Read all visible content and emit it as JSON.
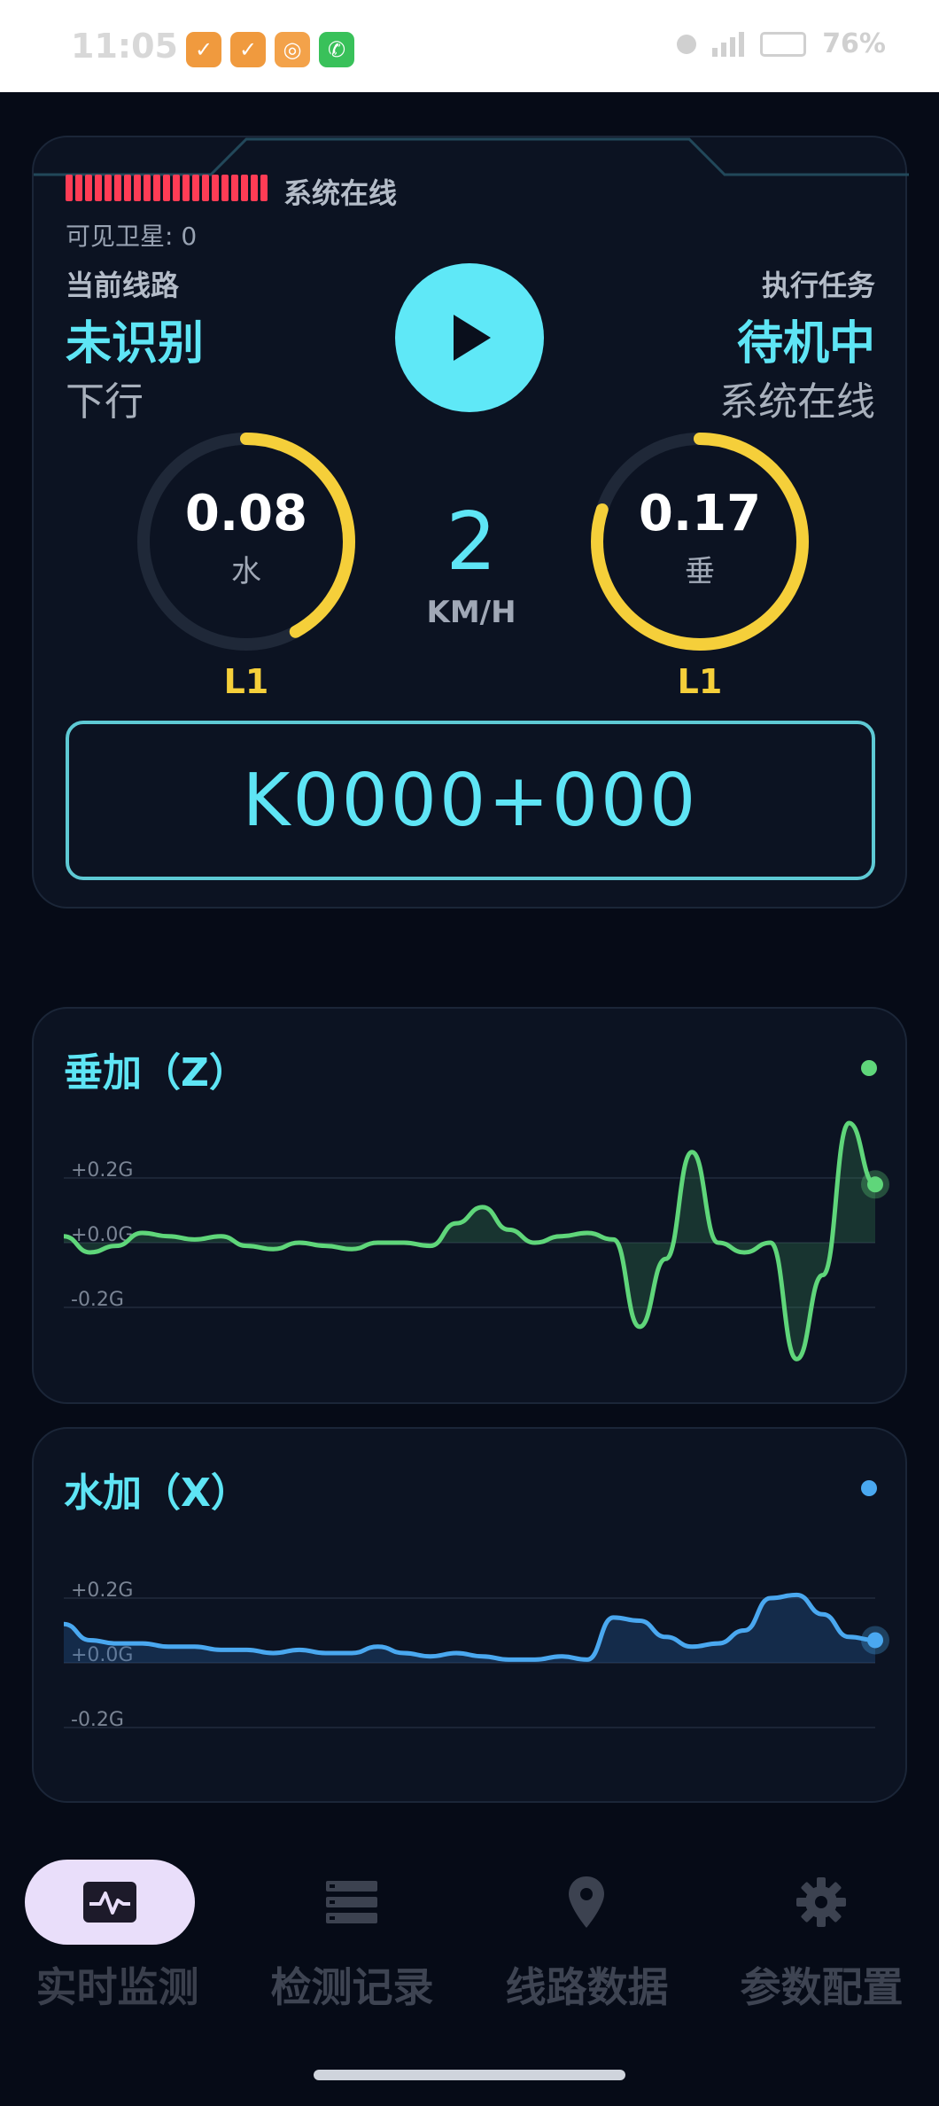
{
  "status_bar": {
    "time": "11:05",
    "battery": "76%",
    "apps": [
      {
        "icon": "app-orange-icon",
        "color": "#f09a3e"
      },
      {
        "icon": "app-orange-icon",
        "color": "#f09a3e"
      },
      {
        "icon": "app-search-icon",
        "color": "#f3a24a"
      },
      {
        "icon": "whatsapp-icon",
        "color": "#39c15a"
      }
    ]
  },
  "header": {
    "system_status": "系统在线",
    "satellites_label": "可见卫星: 0",
    "current_line_title": "当前线路",
    "current_line_value": "未识别",
    "direction": "下行",
    "task_title": "执行任务",
    "task_value": "待机中",
    "task_status": "系统在线"
  },
  "gauges": {
    "left": {
      "value": "0.08",
      "label": "水",
      "level": "L1",
      "fill": 0.42
    },
    "right": {
      "value": "0.17",
      "label": "垂",
      "level": "L1",
      "fill": 0.8
    },
    "speed": {
      "value": "2",
      "unit": "KM/H"
    }
  },
  "mileage": "K0000+000",
  "charts": {
    "vertical": {
      "title": "垂加（Z）",
      "color": "#5fd67a"
    },
    "horizontal": {
      "title": "水加（X）",
      "color": "#4aa8f0"
    }
  },
  "chart_data": [
    {
      "type": "line",
      "title": "垂加（Z）",
      "ytick_labels": [
        "+0.2G",
        "+0.0G",
        "-0.2G"
      ],
      "ylim": [
        -0.4,
        0.4
      ],
      "values": [
        0.02,
        -0.03,
        -0.01,
        0.03,
        0.02,
        0.01,
        0.02,
        -0.01,
        -0.02,
        0.0,
        -0.01,
        -0.02,
        0.0,
        0.0,
        -0.01,
        0.06,
        0.11,
        0.04,
        0.0,
        0.02,
        0.03,
        0.01,
        -0.26,
        -0.05,
        0.28,
        0.0,
        -0.03,
        0.0,
        -0.36,
        -0.1,
        0.37,
        0.18
      ]
    },
    {
      "type": "line",
      "title": "水加（X）",
      "ytick_labels": [
        "+0.2G",
        "+0.0G",
        "-0.2G"
      ],
      "ylim": [
        -0.4,
        0.4
      ],
      "values": [
        0.12,
        0.07,
        0.06,
        0.06,
        0.05,
        0.05,
        0.04,
        0.04,
        0.03,
        0.04,
        0.03,
        0.03,
        0.05,
        0.03,
        0.02,
        0.03,
        0.02,
        0.01,
        0.01,
        0.02,
        0.01,
        0.14,
        0.13,
        0.08,
        0.05,
        0.06,
        0.1,
        0.2,
        0.21,
        0.15,
        0.08,
        0.07
      ]
    }
  ],
  "nav": [
    {
      "label": "实时监测",
      "icon": "pulse-monitor-icon",
      "active": true
    },
    {
      "label": "检测记录",
      "icon": "list-records-icon",
      "active": false
    },
    {
      "label": "线路数据",
      "icon": "location-pin-icon",
      "active": false
    },
    {
      "label": "参数配置",
      "icon": "gear-icon",
      "active": false
    }
  ]
}
